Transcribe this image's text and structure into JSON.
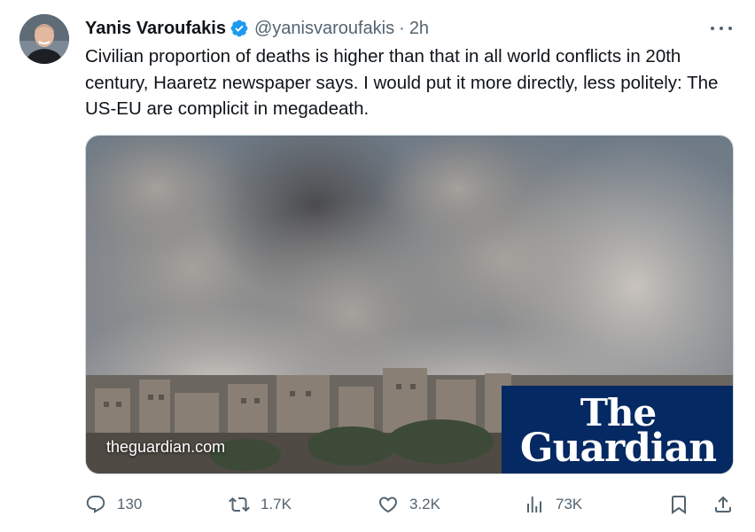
{
  "author": {
    "name": "Yanis Varoufakis",
    "handle": "@yanisvaroufakis",
    "separator": "·",
    "time": "2h"
  },
  "tweet": {
    "text": "Civilian proportion of deaths is higher than that in all world conflicts in 20th century, Haaretz newspaper says. I would put it more directly, less politely: The US-EU are complicit in megadeath."
  },
  "media": {
    "domain": "theguardian.com",
    "logo_line1": "The",
    "logo_line2": "Guardian",
    "logo_color": "#052962"
  },
  "actions": {
    "replies": "130",
    "retweets": "1.7K",
    "likes": "3.2K",
    "views": "73K"
  },
  "colors": {
    "verified": "#1d9bf0",
    "muted": "#536471",
    "text": "#0f1419"
  },
  "icons": [
    "verified-badge-icon",
    "more-icon",
    "reply-icon",
    "retweet-icon",
    "like-icon",
    "views-icon",
    "bookmark-icon",
    "share-icon"
  ]
}
